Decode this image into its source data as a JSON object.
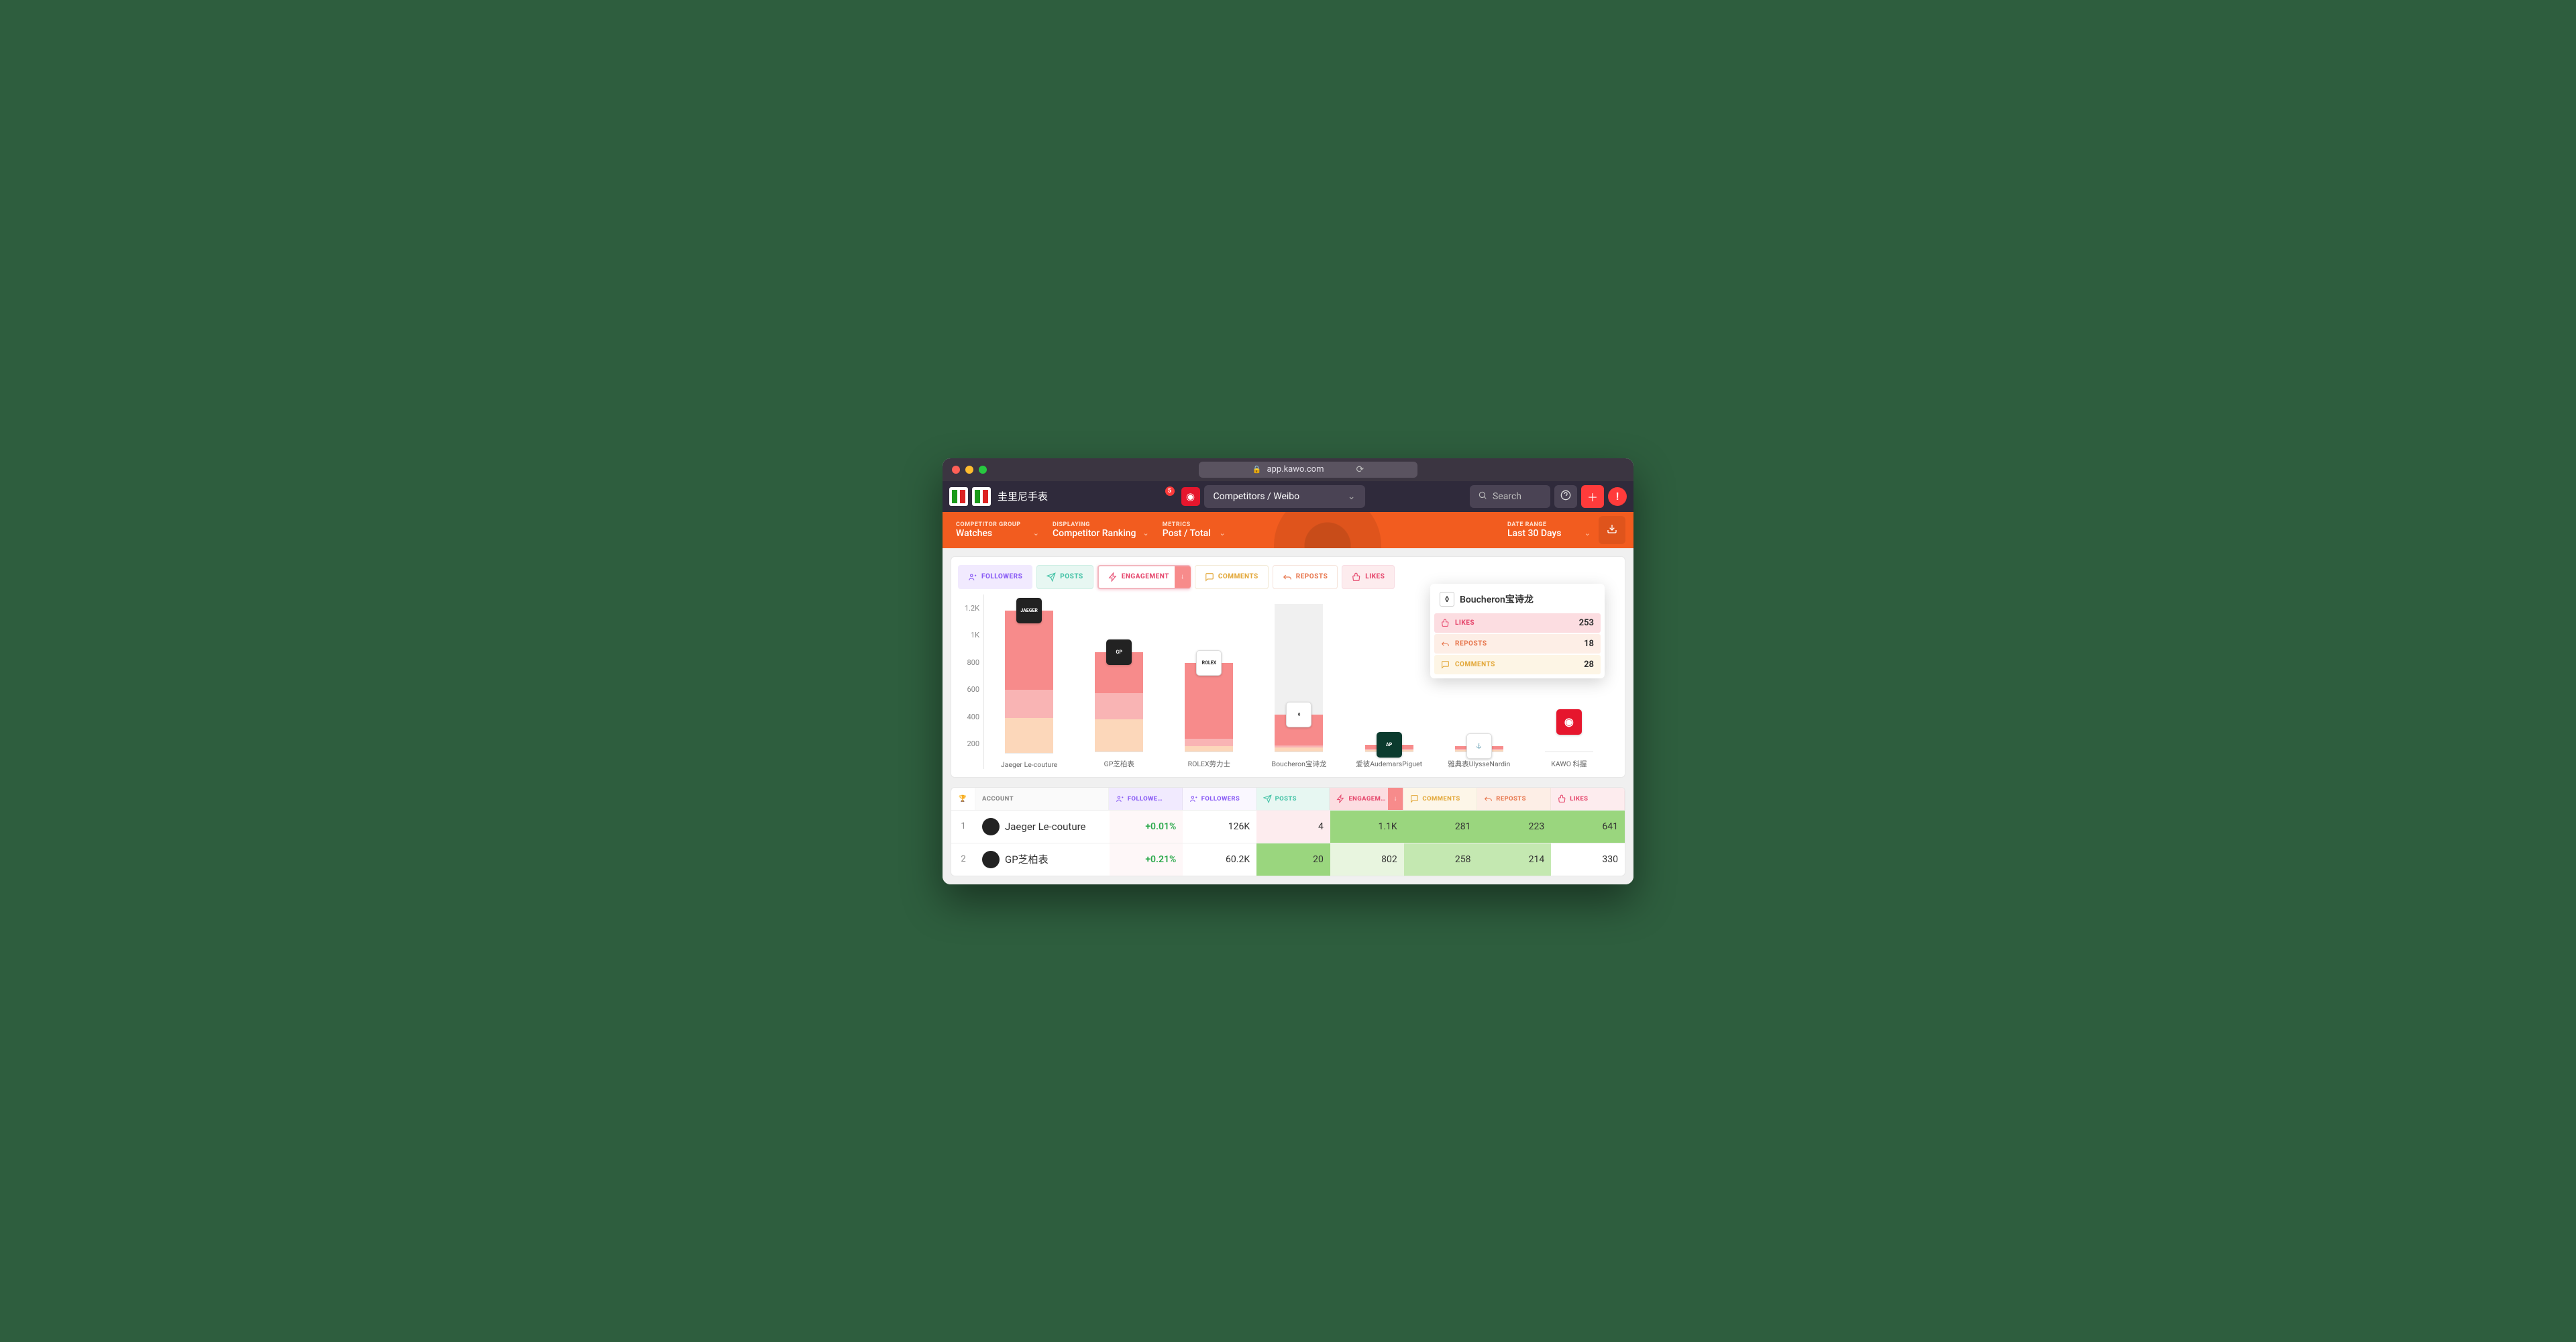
{
  "browser": {
    "url": "app.kawo.com"
  },
  "app_bar": {
    "brand_name": "圭里尼手表",
    "notif_count": "5",
    "breadcrumb": "Competitors / Weibo",
    "search_placeholder": "Search"
  },
  "filters": {
    "group_label": "COMPETITOR GROUP",
    "group_value": "Watches",
    "displaying_label": "DISPLAYING",
    "displaying_value": "Competitor Ranking",
    "metrics_label": "METRICS",
    "metrics_value": "Post / Total",
    "range_label": "DATE RANGE",
    "range_value": "Last 30 Days"
  },
  "tabs": {
    "followers": "FOLLOWERS",
    "posts": "POSTS",
    "engagement": "ENGAGEMENT",
    "comments": "COMMENTS",
    "reposts": "REPOSTS",
    "likes": "LIKES"
  },
  "chart_data": {
    "type": "bar",
    "stacked": true,
    "ylabel": "",
    "ylim": [
      0,
      1200
    ],
    "y_ticks": [
      "1.2K",
      "1K",
      "800",
      "600",
      "400",
      "200"
    ],
    "categories": [
      "Jaeger Le-couture",
      "GP芝柏表",
      "ROLEX劳力士",
      "Boucheron宝诗龙",
      "爱彼AudemarsPiguet",
      "雅典表UlysseNardin",
      "KAWO 科握"
    ],
    "series": [
      {
        "name": "LIKES",
        "values": [
          641,
          330,
          620,
          253,
          30,
          25,
          0
        ]
      },
      {
        "name": "REPOSTS",
        "values": [
          223,
          214,
          60,
          18,
          10,
          10,
          0
        ]
      },
      {
        "name": "COMMENTS",
        "values": [
          281,
          258,
          40,
          28,
          10,
          8,
          0
        ]
      }
    ]
  },
  "tooltip": {
    "title": "Boucheron宝诗龙",
    "likes_label": "LIKES",
    "likes_value": "253",
    "reposts_label": "REPOSTS",
    "reposts_value": "18",
    "comments_label": "COMMENTS",
    "comments_value": "28"
  },
  "table": {
    "headers": {
      "account": "ACCOUNT",
      "followers_pct": "FOLLOWE…",
      "followers": "FOLLOWERS",
      "posts": "POSTS",
      "engagement": "ENGAGEM…",
      "comments": "COMMENTS",
      "reposts": "REPOSTS",
      "likes": "LIKES"
    },
    "rows": [
      {
        "rank": "1",
        "name": "Jaeger Le-couture",
        "pct": "+0.01%",
        "followers": "126K",
        "posts": "4",
        "engagement": "1.1K",
        "comments": "281",
        "reposts": "223",
        "likes": "641"
      },
      {
        "rank": "2",
        "name": "GP芝柏表",
        "pct": "+0.21%",
        "followers": "60.2K",
        "posts": "20",
        "engagement": "802",
        "comments": "258",
        "reposts": "214",
        "likes": "330"
      }
    ]
  }
}
